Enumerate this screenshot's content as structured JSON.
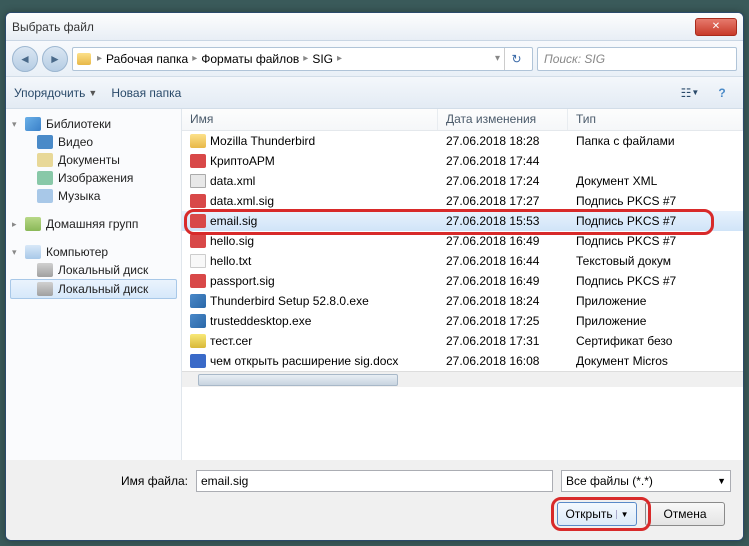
{
  "window": {
    "title": "Выбрать файл"
  },
  "nav": {
    "breadcrumbs": [
      "Рабочая папка",
      "Форматы файлов",
      "SIG"
    ],
    "search_placeholder": "Поиск: SIG"
  },
  "toolbar": {
    "organize": "Упорядочить",
    "new_folder": "Новая папка"
  },
  "sidebar": {
    "libraries": {
      "label": "Библиотеки",
      "items": [
        "Видео",
        "Документы",
        "Изображения",
        "Музыка"
      ]
    },
    "homegroup": "Домашняя групп",
    "computer": {
      "label": "Компьютер",
      "items": [
        "Локальный диск",
        "Локальный диск"
      ]
    }
  },
  "columns": {
    "name": "Имя",
    "date": "Дата изменения",
    "type": "Тип"
  },
  "files": [
    {
      "icon": "fi-folder",
      "name": "Mozilla Thunderbird",
      "date": "27.06.2018 18:28",
      "type": "Папка с файлами"
    },
    {
      "icon": "fi-sig",
      "name": "КриптоАРМ",
      "date": "27.06.2018 17:44",
      "type": ""
    },
    {
      "icon": "fi-xml",
      "name": "data.xml",
      "date": "27.06.2018 17:24",
      "type": "Документ XML"
    },
    {
      "icon": "fi-sig",
      "name": "data.xml.sig",
      "date": "27.06.2018 17:27",
      "type": "Подпись PKCS #7"
    },
    {
      "icon": "fi-sig",
      "name": "email.sig",
      "date": "27.06.2018 15:53",
      "type": "Подпись PKCS #7",
      "selected": true
    },
    {
      "icon": "fi-sig",
      "name": "hello.sig",
      "date": "27.06.2018 16:49",
      "type": "Подпись PKCS #7"
    },
    {
      "icon": "fi-txt",
      "name": "hello.txt",
      "date": "27.06.2018 16:44",
      "type": "Текстовый докум"
    },
    {
      "icon": "fi-sig",
      "name": "passport.sig",
      "date": "27.06.2018 16:49",
      "type": "Подпись PKCS #7"
    },
    {
      "icon": "fi-exe",
      "name": "Thunderbird Setup 52.8.0.exe",
      "date": "27.06.2018 18:24",
      "type": "Приложение"
    },
    {
      "icon": "fi-exe",
      "name": "trusteddesktop.exe",
      "date": "27.06.2018 17:25",
      "type": "Приложение"
    },
    {
      "icon": "fi-cer",
      "name": "тест.cer",
      "date": "27.06.2018 17:31",
      "type": "Сертификат безо"
    },
    {
      "icon": "fi-docx",
      "name": "чем открыть расширение sig.docx",
      "date": "27.06.2018 16:08",
      "type": "Документ Micros"
    }
  ],
  "footer": {
    "filename_label": "Имя файла:",
    "filename_value": "email.sig",
    "filter": "Все файлы (*.*)",
    "open": "Открыть",
    "cancel": "Отмена"
  }
}
